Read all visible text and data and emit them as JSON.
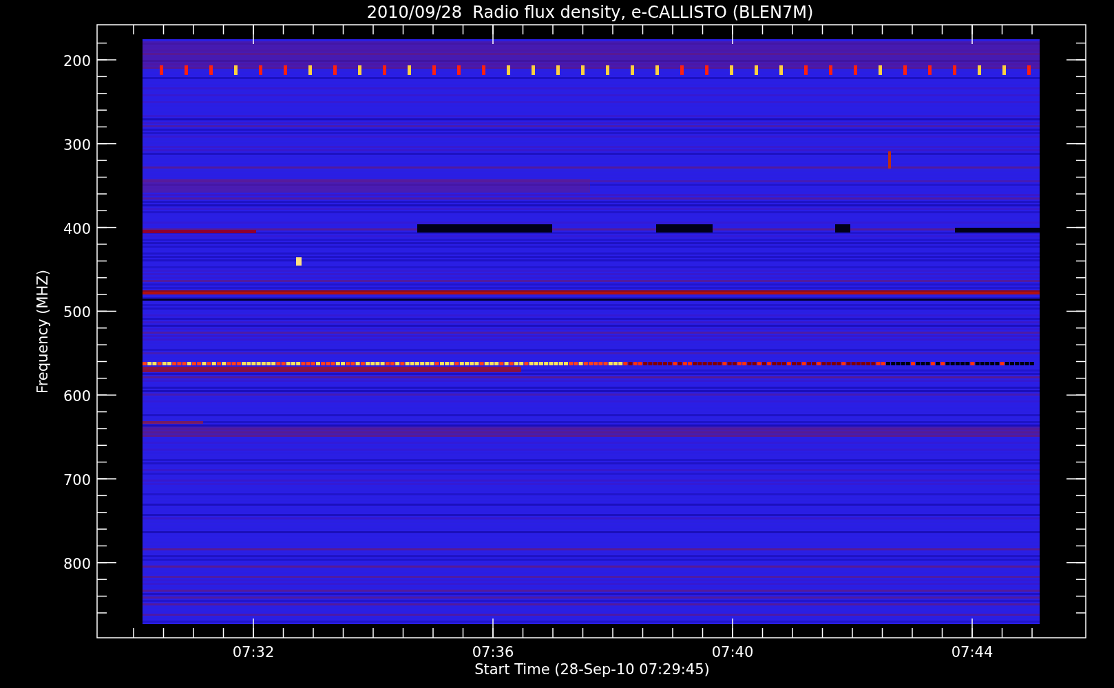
{
  "plot": {
    "title": "2010/09/28  Radio flux density, e-CALLISTO (BLEN7M)",
    "ylabel": "Frequency (MHZ)",
    "xlabel": "Start Time (28-Sep-10 07:29:45)",
    "yticks": [
      "200",
      "300",
      "400",
      "500",
      "600",
      "700",
      "800"
    ],
    "xticks": [
      "07:32",
      "07:36",
      "07:40",
      "07:44"
    ]
  }
}
